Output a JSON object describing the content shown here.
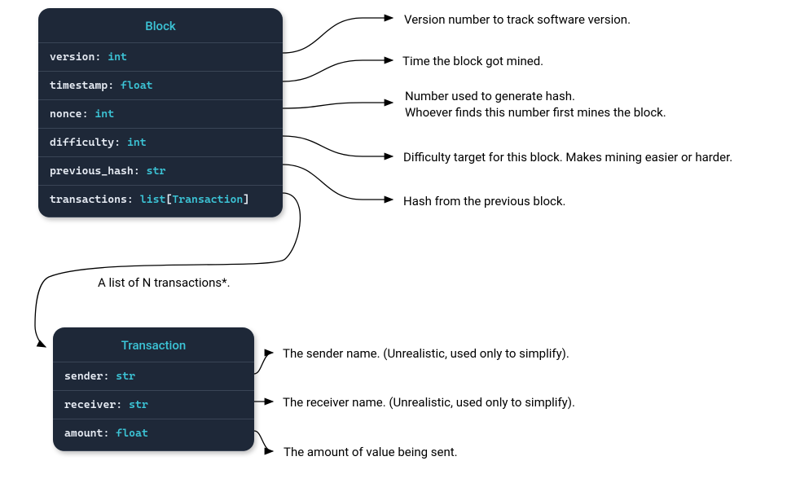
{
  "block": {
    "title": "Block",
    "fields": [
      {
        "name": "version",
        "type": "int"
      },
      {
        "name": "timestamp",
        "type": "float"
      },
      {
        "name": "nonce",
        "type": "int"
      },
      {
        "name": "difficulty",
        "type": "int"
      },
      {
        "name": "previous_hash",
        "type": "str"
      },
      {
        "name": "transactions",
        "type_prefix": "list",
        "type_param": "Transaction"
      }
    ]
  },
  "transaction": {
    "title": "Transaction",
    "fields": [
      {
        "name": "sender",
        "type": "str"
      },
      {
        "name": "receiver",
        "type": "str"
      },
      {
        "name": "amount",
        "type": "float"
      }
    ]
  },
  "descriptions": {
    "version": "Version number to track software version.",
    "timestamp": "Time the block got mined.",
    "nonce_line1": "Number used to generate hash.",
    "nonce_line2": "Whoever finds this number first mines the block.",
    "difficulty": "Difficulty target for this block. Makes mining easier or harder.",
    "previous_hash": "Hash from the previous block.",
    "transactions_link": "A list of N transactions*.",
    "sender": "The sender name. (Unrealistic, used only to simplify).",
    "receiver": "The receiver name. (Unrealistic, used only to simplify).",
    "amount": "The amount of value being sent."
  }
}
